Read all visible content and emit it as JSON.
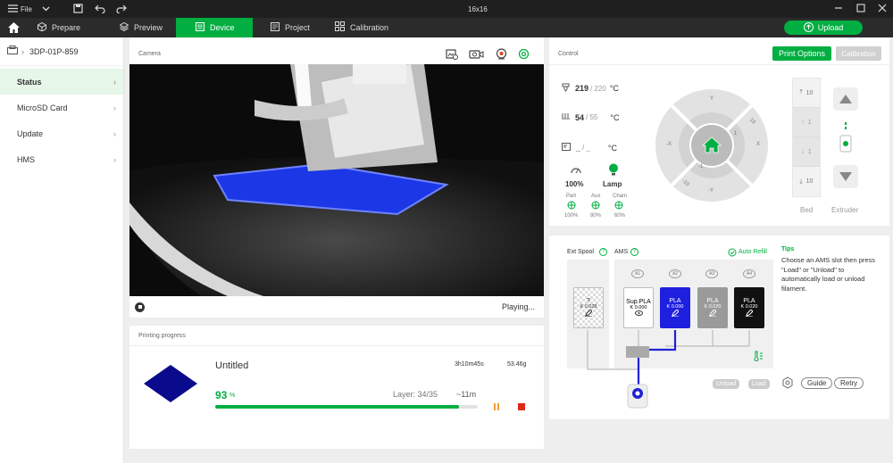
{
  "titlebar": {
    "menu_label": "File",
    "doc_title": "16x16"
  },
  "nav": {
    "tabs": [
      {
        "label": "Prepare"
      },
      {
        "label": "Preview"
      },
      {
        "label": "Device"
      },
      {
        "label": "Project"
      },
      {
        "label": "Calibration"
      }
    ],
    "upload_label": "Upload"
  },
  "sidebar": {
    "device_name": "3DP-01P-859",
    "items": [
      {
        "label": "Status"
      },
      {
        "label": "MicroSD Card"
      },
      {
        "label": "Update"
      },
      {
        "label": "HMS"
      }
    ]
  },
  "camera": {
    "title": "Camera",
    "play_status": "Playing..."
  },
  "progress": {
    "title": "Printing progress",
    "job_name": "Untitled",
    "time": "3h10m45s",
    "weight": "53.46g",
    "percent": "93",
    "percent_unit": "%",
    "percent_value": 0.93,
    "layer": "Layer: 34/35",
    "remaining": "~11m"
  },
  "control": {
    "title": "Control",
    "print_options_label": "Print Options",
    "calibration_label": "Calibration",
    "nozzle": {
      "current": "219",
      "target": "/ 220",
      "unit": "°C"
    },
    "bed": {
      "current": "54",
      "target": "/ 55",
      "unit": "°C"
    },
    "chamber": {
      "current": "_",
      "target": "/ _",
      "unit": "°C"
    },
    "fan_speed": "100%",
    "lamp_label": "Lamp",
    "fans": [
      {
        "label": "Part",
        "value": "100%"
      },
      {
        "label": "Aux",
        "value": "80%"
      },
      {
        "label": "Cham",
        "value": "60%"
      }
    ],
    "jog": {
      "y_up": "Y",
      "y_down": "-Y",
      "x_left": "-X",
      "x_right": "X",
      "p10": "10",
      "p1": "1",
      "m1": "-1",
      "m10": "-10"
    },
    "bed_steps": [
      "10",
      "1",
      "1",
      "10"
    ],
    "bed_label": "Bed",
    "extruder_label": "Extruder"
  },
  "ams": {
    "ext_spool_label": "Ext Spool",
    "ams_label": "AMS",
    "help": "?",
    "auto_refill_label": "Auto Refill",
    "ext_slot": {
      "name": "?",
      "k": "K 0.028"
    },
    "slots": [
      {
        "id": "A1",
        "name": "Sup.PLA",
        "k": "K 0.000",
        "color": "#ffffff",
        "text_color": "#000000"
      },
      {
        "id": "A2",
        "name": "PLA",
        "k": "K 0.000",
        "color": "#1f1fe0",
        "text_color": "#ffffff"
      },
      {
        "id": "A3",
        "name": "PLA",
        "k": "K 0.020",
        "color": "#9a9a9a",
        "text_color": "#ffffff"
      },
      {
        "id": "A4",
        "name": "PLA",
        "k": "K 0.020",
        "color": "#111111",
        "text_color": "#ffffff"
      }
    ],
    "tips_title": "Tips",
    "tips_text": "Choose an AMS slot then press \"Load\" or \"Unload\" to automatically load or unload filament.",
    "unload_label": "Unload",
    "load_label": "Load",
    "guide_label": "Guide",
    "retry_label": "Retry"
  }
}
